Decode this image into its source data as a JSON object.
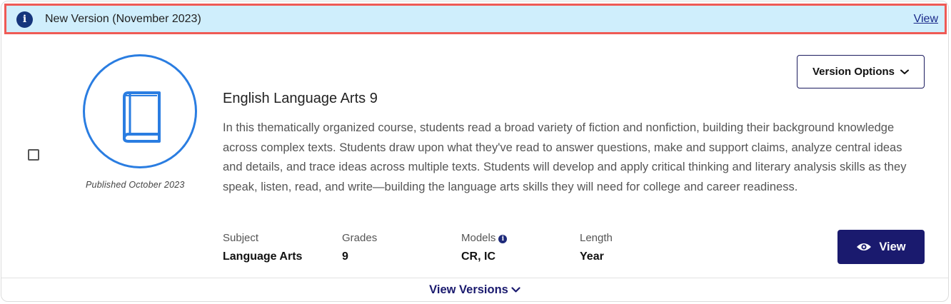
{
  "banner": {
    "icon": "info-icon",
    "icon_glyph": "i",
    "text": "New Version (November 2023)",
    "link_label": "View"
  },
  "course": {
    "cover_icon": "book-icon",
    "published": "Published October 2023",
    "title": "English Language Arts 9",
    "description": "In this thematically organized course, students read a broad variety of fiction and nonfiction, building their background knowledge across complex texts. Students draw upon what they've read to answer questions, make and support claims, analyze central ideas and details, and trace ideas across multiple texts. Students will develop and apply critical thinking and literary analysis skills as they speak, listen, read, and write—building the language arts skills they will need for college and career readiness.",
    "meta": {
      "subject_label": "Subject",
      "subject_value": "Language Arts",
      "grades_label": "Grades",
      "grades_value": "9",
      "models_label": "Models",
      "models_info_glyph": "i",
      "models_value": "CR, IC",
      "length_label": "Length",
      "length_value": "Year"
    }
  },
  "actions": {
    "version_options_label": "Version Options",
    "view_label": "View",
    "view_versions_label": "View Versions"
  },
  "colors": {
    "banner_bg": "#cfeefc",
    "banner_border": "#ef5a55",
    "accent_blue": "#2a7de1",
    "primary_navy": "#1a1a6e"
  }
}
